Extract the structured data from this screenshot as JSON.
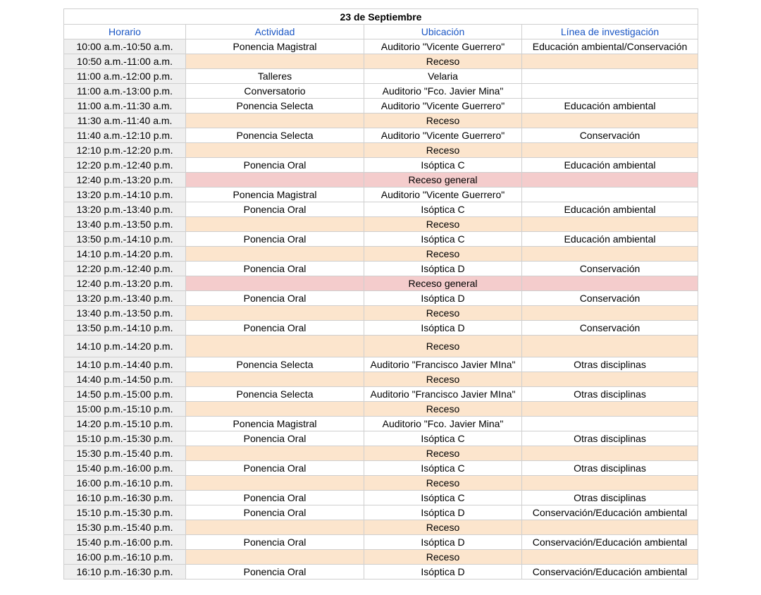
{
  "table": {
    "title": "23 de Septiembre",
    "headers": [
      "Horario",
      "Actividad",
      "Ubicación",
      "Línea de investigación"
    ],
    "rows": [
      {
        "time": "10:00 a.m.-10:50 a.m.",
        "activity": "Ponencia Magistral",
        "location": "Auditorio \"Vicente Guerrero\"",
        "line": "Educación ambiental/Conservación",
        "kind": "normal"
      },
      {
        "time": "10:50 a.m.-11:00 a.m.",
        "activity": "",
        "location": "Receso",
        "line": "",
        "kind": "break"
      },
      {
        "time": "11:00 a.m.-12:00 p.m.",
        "activity": "Talleres",
        "location": "Velaria",
        "line": "",
        "kind": "normal"
      },
      {
        "time": "11:00 a.m.-13:00 p.m.",
        "activity": "Conversatorio",
        "location": "Auditorio  \"Fco. Javier Mina\"",
        "line": "",
        "kind": "normal"
      },
      {
        "time": "11:00 a.m.-11:30 a.m.",
        "activity": "Ponencia Selecta",
        "location": "Auditorio \"Vicente Guerrero\"",
        "line": "Educación ambiental",
        "kind": "normal"
      },
      {
        "time": "11:30 a.m.-11:40 a.m.",
        "activity": "",
        "location": "Receso",
        "line": "",
        "kind": "break"
      },
      {
        "time": "11:40 a.m.-12:10 p.m.",
        "activity": "Ponencia Selecta",
        "location": "Auditorio \"Vicente Guerrero\"",
        "line": "Conservación",
        "kind": "normal"
      },
      {
        "time": "12:10 p.m.-12:20 p.m.",
        "activity": "",
        "location": "Receso",
        "line": "",
        "kind": "break"
      },
      {
        "time": "12:20 p.m.-12:40 p.m.",
        "activity": "Ponencia Oral",
        "location": "Isóptica C",
        "line": "Educación ambiental",
        "kind": "normal"
      },
      {
        "time": "12:40 p.m.-13:20 p.m.",
        "activity": "",
        "location": "Receso general",
        "line": "",
        "kind": "general"
      },
      {
        "time": "13:20 p.m.-14:10 p.m.",
        "activity": "Ponencia Magistral",
        "location": "Auditorio \"Vicente Guerrero\"",
        "line": "",
        "kind": "normal"
      },
      {
        "time": "13:20 p.m.-13:40 p.m.",
        "activity": "Ponencia Oral",
        "location": "Isóptica C",
        "line": "Educación ambiental",
        "kind": "normal"
      },
      {
        "time": "13:40 p.m.-13:50 p.m.",
        "activity": "",
        "location": "Receso",
        "line": "",
        "kind": "break"
      },
      {
        "time": "13:50 p.m.-14:10 p.m.",
        "activity": "Ponencia Oral",
        "location": "Isóptica C",
        "line": "Educación ambiental",
        "kind": "normal"
      },
      {
        "time": "14:10 p.m.-14:20 p.m.",
        "activity": "",
        "location": "Receso",
        "line": "",
        "kind": "break"
      },
      {
        "time": "12:20 p.m.-12:40 p.m.",
        "activity": "Ponencia Oral",
        "location": "Isóptica D",
        "line": "Conservación",
        "kind": "normal"
      },
      {
        "time": "12:40 p.m.-13:20 p.m.",
        "activity": "",
        "location": "Receso general",
        "line": "",
        "kind": "general"
      },
      {
        "time": "13:20 p.m.-13:40 p.m.",
        "activity": "Ponencia Oral",
        "location": "Isóptica D",
        "line": "Conservación",
        "kind": "normal"
      },
      {
        "time": "13:40 p.m.-13:50 p.m.",
        "activity": "",
        "location": "Receso",
        "line": "",
        "kind": "break"
      },
      {
        "time": "13:50 p.m.-14:10 p.m.",
        "activity": "Ponencia Oral",
        "location": "Isóptica D",
        "line": "Conservación",
        "kind": "normal"
      },
      {
        "time": "14:10 p.m.-14:20 p.m.",
        "activity": "",
        "location": "Receso",
        "line": "",
        "kind": "break",
        "tall": true
      },
      {
        "time": "14:10 p.m.-14:40 p.m.",
        "activity": "Ponencia Selecta",
        "location": "Auditorio \"Francisco Javier MIna\"",
        "line": "Otras disciplinas",
        "kind": "normal"
      },
      {
        "time": "14:40 p.m.-14:50 p.m.",
        "activity": "",
        "location": "Receso",
        "line": "",
        "kind": "break"
      },
      {
        "time": "14:50 p.m.-15:00 p.m.",
        "activity": "Ponencia Selecta",
        "location": "Auditorio \"Francisco Javier MIna\"",
        "line": "Otras disciplinas",
        "kind": "normal"
      },
      {
        "time": "15:00 p.m.-15:10 p.m.",
        "activity": "",
        "location": "Receso",
        "line": "",
        "kind": "break"
      },
      {
        "time": "14:20 p.m.-15:10 p.m.",
        "activity": "Ponencia Magistral",
        "location": "Auditorio  \"Fco. Javier Mina\"",
        "line": "",
        "kind": "normal"
      },
      {
        "time": "15:10 p.m.-15:30 p.m.",
        "activity": "Ponencia Oral",
        "location": "Isóptica C",
        "line": "Otras disciplinas",
        "kind": "normal"
      },
      {
        "time": "15:30 p.m.-15:40 p.m.",
        "activity": "",
        "location": "Receso",
        "line": "",
        "kind": "break"
      },
      {
        "time": "15:40 p.m.-16:00 p.m.",
        "activity": "Ponencia Oral",
        "location": "Isóptica C",
        "line": "Otras disciplinas",
        "kind": "normal"
      },
      {
        "time": "16:00 p.m.-16:10 p.m.",
        "activity": "",
        "location": "Receso",
        "line": "",
        "kind": "break"
      },
      {
        "time": "16:10 p.m.-16:30 p.m.",
        "activity": "Ponencia Oral",
        "location": "Isóptica C",
        "line": "Otras disciplinas",
        "kind": "normal"
      },
      {
        "time": "15:10 p.m.-15:30 p.m.",
        "activity": "Ponencia Oral",
        "location": "Isóptica D",
        "line": "Conservación/Educación ambiental",
        "kind": "normal"
      },
      {
        "time": "15:30 p.m.-15:40 p.m.",
        "activity": "",
        "location": "Receso",
        "line": "",
        "kind": "break"
      },
      {
        "time": "15:40 p.m.-16:00 p.m.",
        "activity": "Ponencia Oral",
        "location": "Isóptica D",
        "line": "Conservación/Educación ambiental",
        "kind": "normal"
      },
      {
        "time": "16:00 p.m.-16:10 p.m.",
        "activity": "",
        "location": "Receso",
        "line": "",
        "kind": "break"
      },
      {
        "time": "16:10 p.m.-16:30 p.m.",
        "activity": "Ponencia Oral",
        "location": "Isóptica D",
        "line": "Conservación/Educación ambiental",
        "kind": "normal"
      }
    ]
  },
  "colors": {
    "header_text": "#1a56c4",
    "break_fill": "#fce5cd",
    "general_break_fill": "#f4cccc",
    "time_fill": "#efefef",
    "grid": "#cfcfcf"
  }
}
